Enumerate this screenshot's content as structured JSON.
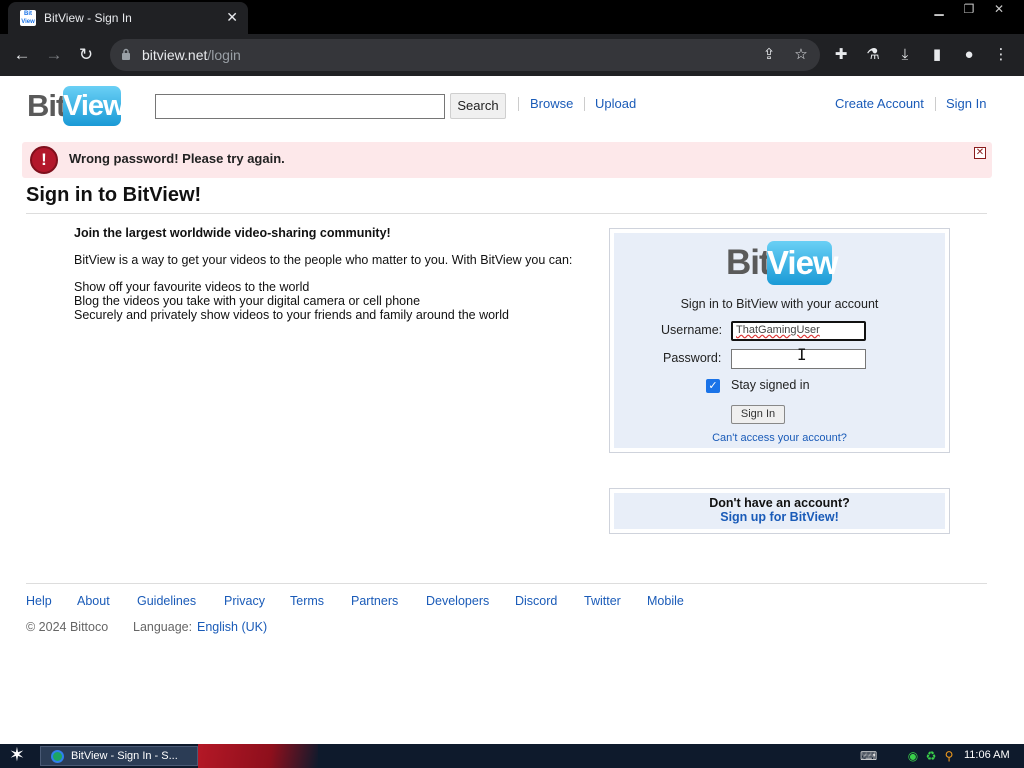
{
  "browser": {
    "tab_title": "BitView - Sign In",
    "favicon_text": "Bit View",
    "url_host": "bitview.net",
    "url_path": "/login",
    "window_controls": [
      "minimize",
      "restore",
      "close"
    ]
  },
  "header": {
    "logo_bit": "Bit",
    "logo_view": "View",
    "search_button": "Search",
    "nav": [
      "Browse",
      "Upload"
    ],
    "account": [
      "Create Account",
      "Sign In"
    ]
  },
  "alert": {
    "message": "Wrong password! Please try again."
  },
  "page_title": "Sign in to BitView!",
  "join": {
    "heading": "Join the largest worldwide video-sharing community!",
    "intro": "BitView is a way to get your videos to the people who matter to you. With BitView you can:",
    "bullets": [
      "Show off your favourite videos to the world",
      "Blog the videos you take with your digital camera or cell phone",
      "Securely and privately show videos to your friends and family around the world"
    ]
  },
  "signin": {
    "caption": "Sign in to BitView with your account",
    "username_label": "Username:",
    "username_value": "ThatGamingUser",
    "password_label": "Password:",
    "password_value": "",
    "stay_signed_in": "Stay signed in",
    "stay_checked": true,
    "button": "Sign In",
    "cant_access": "Can't access your account?"
  },
  "signup": {
    "question": "Don't have an account?",
    "link": "Sign up for BitView!"
  },
  "footer": {
    "links": [
      "Help",
      "About",
      "Guidelines",
      "Privacy",
      "Terms",
      "Partners",
      "Developers",
      "Discord",
      "Twitter",
      "Mobile"
    ],
    "copyright": "© 2024 Bittoco",
    "language_label": "Language:",
    "language_value": "English (UK)"
  },
  "taskbar": {
    "task_label": "BitView - Sign In - S...",
    "clock": "11:06 AM"
  },
  "colors": {
    "link": "#1a5bb8",
    "error_bg": "#fde8ea",
    "panel_bg": "#e8eef8",
    "logo_blue": "#1a9ad6"
  }
}
